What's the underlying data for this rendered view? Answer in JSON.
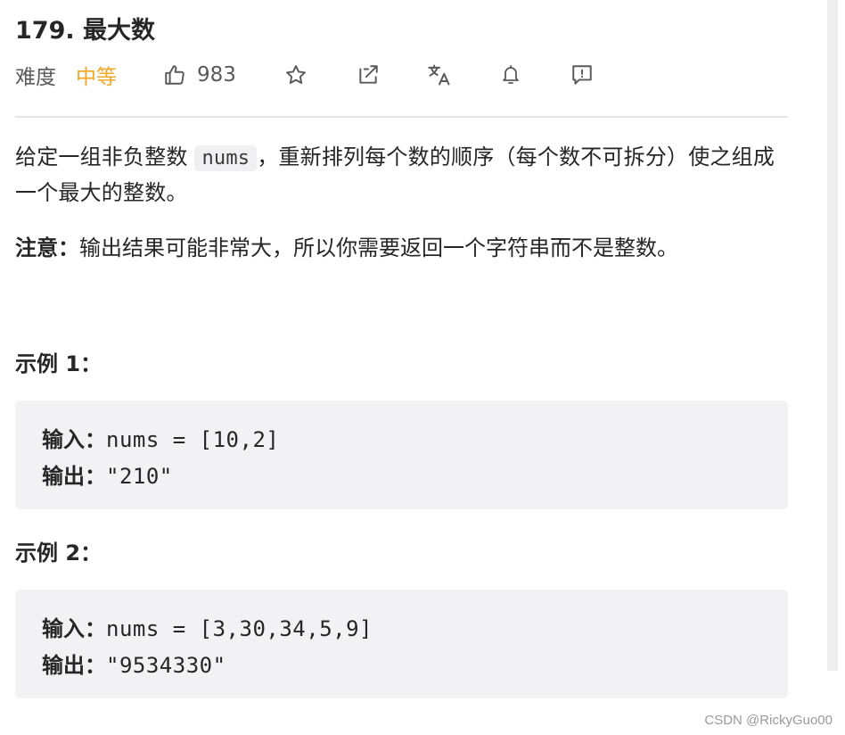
{
  "problem": {
    "title": "179. 最大数",
    "difficulty_label": "难度",
    "difficulty_value": "中等",
    "likes": "983"
  },
  "toolbar": {
    "icons": [
      "thumbs-up-icon",
      "star-icon",
      "share-icon",
      "translate-icon",
      "bell-icon",
      "feedback-icon"
    ]
  },
  "description": {
    "part1": "给定一组非负整数 ",
    "code": "nums",
    "part2": "，重新排列每个数的顺序（每个数不可拆分）使之组成一个最大的整数。"
  },
  "note": {
    "label": "注意：",
    "text": "输出结果可能非常大，所以你需要返回一个字符串而不是整数。"
  },
  "examples": [
    {
      "title": "示例 1：",
      "input_label": "输入：",
      "input": "nums = [10,2]",
      "output_label": "输出：",
      "output": "\"210\""
    },
    {
      "title": "示例 2：",
      "input_label": "输入：",
      "input": "nums = [3,30,34,5,9]",
      "output_label": "输出：",
      "output": "\"9534330\""
    }
  ],
  "watermark": "CSDN @RickyGuo00",
  "colors": {
    "difficulty_medium": "#f5a623",
    "text": "#262626",
    "code_bg": "#f2f2f4"
  }
}
